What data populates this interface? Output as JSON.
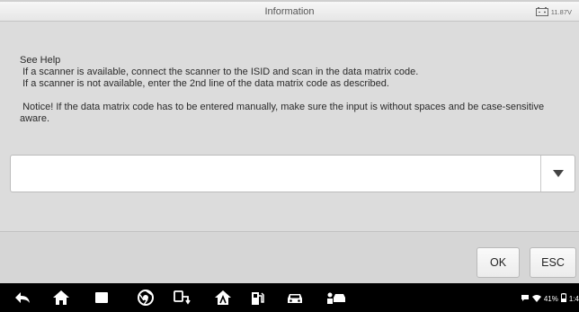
{
  "window": {
    "title": "Information",
    "battery_voltage": "11.87V"
  },
  "help": {
    "heading": "See Help",
    "line1": " If a scanner is available, connect the scanner to the ISID and scan in the data matrix code.",
    "line2": " If a scanner is not available, enter the 2nd line of the data matrix code as described.",
    "notice": " Notice! If the data matrix code has to be entered manually, make sure the input is without spaces and be case-sensitive aware."
  },
  "input": {
    "value": ""
  },
  "buttons": {
    "ok": "OK",
    "esc": "ESC"
  },
  "nav": {
    "icons": [
      "back-icon",
      "home-icon",
      "recent-apps-icon",
      "browser-icon",
      "vci-connection-icon",
      "autel-home-icon",
      "gas-station-icon",
      "car-icon",
      "service-icon"
    ]
  },
  "status": {
    "battery_percent": "41%",
    "time": "1:4"
  }
}
